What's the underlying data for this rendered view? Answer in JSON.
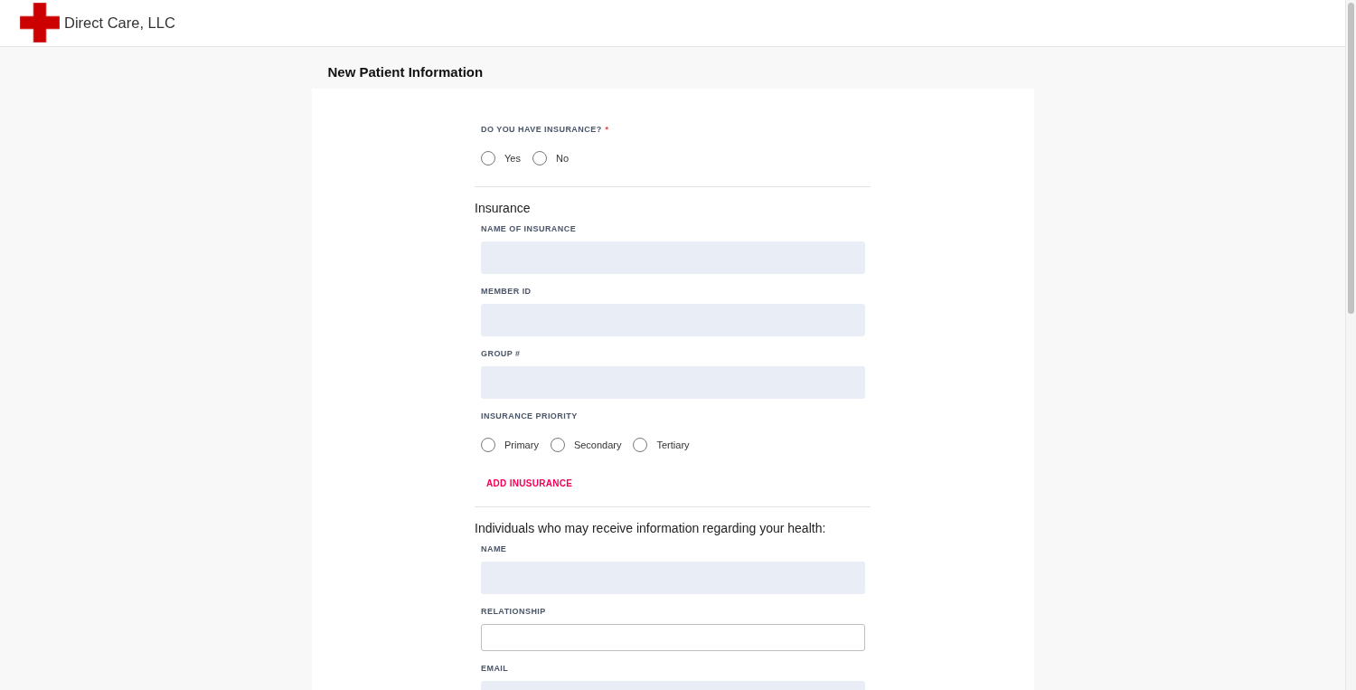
{
  "header": {
    "logo_text": "Direct Care, LLC"
  },
  "page_title": "New Patient Information",
  "form": [
    {
      "kind": "radio_group",
      "label": "DO YOU HAVE INSURANCE?",
      "required_mark": "*",
      "options": [
        {
          "label": "Yes",
          "selected": false
        },
        {
          "label": "No",
          "selected": false
        }
      ]
    },
    {
      "kind": "divider"
    },
    {
      "kind": "heading",
      "text": "Insurance"
    },
    {
      "kind": "text_field",
      "label": "NAME OF INSURANCE",
      "focused": false
    },
    {
      "kind": "text_field",
      "label": "MEMBER ID",
      "focused": false
    },
    {
      "kind": "text_field",
      "label": "GROUP #",
      "focused": false
    },
    {
      "kind": "radio_group",
      "label": "INSURANCE PRIORITY",
      "options": [
        {
          "label": "Primary",
          "selected": false
        },
        {
          "label": "Secondary",
          "selected": false
        },
        {
          "label": "Tertiary",
          "selected": false
        }
      ]
    },
    {
      "kind": "link_button",
      "label": "ADD INUSURANCE"
    },
    {
      "kind": "divider"
    },
    {
      "kind": "heading",
      "text": "Individuals who may receive information regarding your health:"
    },
    {
      "kind": "text_field",
      "label": "NAME",
      "focused": false
    },
    {
      "kind": "text_field",
      "label": "RELATIONSHIP",
      "focused": true
    },
    {
      "kind": "text_field",
      "label": "EMAIL",
      "focused": false
    }
  ]
}
